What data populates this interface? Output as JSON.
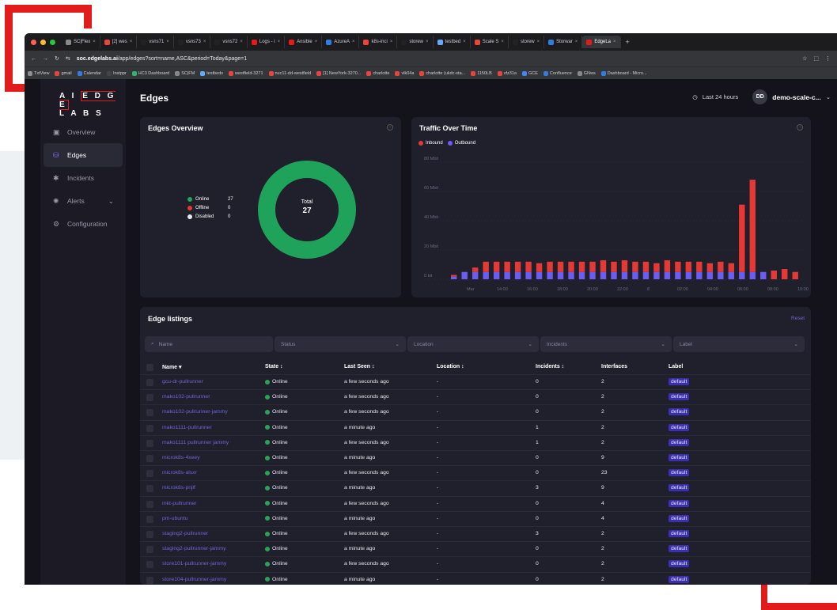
{
  "browser": {
    "tabs": [
      {
        "label": "SC|Flex",
        "color": "#888888"
      },
      {
        "label": "[2] wes",
        "color": "#e8453c"
      },
      {
        "label": "vsns71",
        "color": "#222222"
      },
      {
        "label": "vsns73",
        "color": "#222222"
      },
      {
        "label": "vsns72",
        "color": "#222222"
      },
      {
        "label": "Logs - i",
        "color": "#e21b1b"
      },
      {
        "label": "Ansible",
        "color": "#e21b1b"
      },
      {
        "label": "AzureA",
        "color": "#2f7de1"
      },
      {
        "label": "k8s-inci",
        "color": "#e8453c"
      },
      {
        "label": "storew",
        "color": "#222222"
      },
      {
        "label": "testbed",
        "color": "#6aa7ff"
      },
      {
        "label": "Scale S",
        "color": "#e8453c"
      },
      {
        "label": "storew",
        "color": "#222222"
      },
      {
        "label": "Storwar",
        "color": "#2f7de1"
      },
      {
        "label": "EdgeLa",
        "color": "#e21b1b",
        "active": true
      }
    ],
    "new_tab": "+",
    "url_host": "soc.edgelabs.ai",
    "url_path": "/app/edges?sort=name,ASC&period=Today&page=1",
    "bookmarks": [
      "TxtView",
      "gmail",
      "Calendar",
      "Instppr",
      "HC3 Dashboard",
      "SC|FM",
      "testbeds",
      "westfield-3271",
      "nuc11-dd-westfield",
      "[1] NewYork-3270...",
      "charlotte",
      "vlk04a",
      "charlotte (ukdc-sta...",
      "1150LB",
      "vfz31a",
      "GCE",
      "Confluence",
      "GNws",
      "Dashboard - Micro..."
    ]
  },
  "logo": {
    "part1": "A I",
    "boxed": "E D G E",
    "part2": "L A B S"
  },
  "sidebar": {
    "items": [
      {
        "label": "Overview",
        "icon": "overview-icon",
        "glyph": "▣"
      },
      {
        "label": "Edges",
        "icon": "edges-icon",
        "glyph": "⛁",
        "active": true
      },
      {
        "label": "Incidents",
        "icon": "incidents-icon",
        "glyph": "✱"
      },
      {
        "label": "Alerts",
        "icon": "alerts-icon",
        "glyph": "✺",
        "chevron": "⌄"
      },
      {
        "label": "Configuration",
        "icon": "configuration-icon",
        "glyph": "⚙"
      }
    ]
  },
  "header": {
    "title": "Edges",
    "period": "Last 24 hours",
    "avatar": "DD",
    "account": "demo-scale-c...",
    "clock_glyph": "◷",
    "chevron": "⌄"
  },
  "overview": {
    "title": "Edges Overview",
    "legend": [
      {
        "label": "Online",
        "value": "27",
        "color": "#22a65a"
      },
      {
        "label": "Offline",
        "value": "0",
        "color": "#e53935"
      },
      {
        "label": "Disabled",
        "value": "0",
        "color": "#e9e8ef"
      }
    ],
    "total_label": "Total",
    "total_value": "27",
    "donut_color": "#1fa35a"
  },
  "traffic": {
    "title": "Traffic Over Time",
    "legend": [
      {
        "label": "Inbound",
        "color": "#e53935"
      },
      {
        "label": "Outbound",
        "color": "#6a5cf5"
      }
    ]
  },
  "chart_data": {
    "type": "bar",
    "stacked": true,
    "title": "Traffic Over Time",
    "y_ticks": [
      "80 Mbit",
      "60 Mbit",
      "40 Mbit",
      "20 Mbit",
      "0 bit"
    ],
    "ylim": [
      0,
      80
    ],
    "x_ticks": [
      "Mar",
      "14:00",
      "16:00",
      "18:00",
      "20:00",
      "22:00",
      "8",
      "02:00",
      "04:00",
      "06:00",
      "08:00",
      "10:00"
    ],
    "series": [
      {
        "name": "Outbound",
        "color": "#6a5cf5",
        "values": [
          2,
          5,
          5,
          5,
          5,
          5,
          5,
          5,
          5,
          5,
          5,
          5,
          5,
          5,
          5,
          5,
          5,
          5,
          5,
          5,
          5,
          5,
          5,
          5,
          5,
          5,
          5,
          5,
          5,
          5
        ]
      },
      {
        "name": "Inbound",
        "color": "#e53935",
        "values": [
          1,
          0,
          3,
          7,
          7,
          7,
          7,
          7,
          6,
          7,
          7,
          7,
          7,
          7,
          8,
          7,
          8,
          7,
          7,
          6,
          8,
          7,
          7,
          7,
          6,
          7,
          6,
          46,
          63,
          0,
          6,
          7,
          5
        ]
      }
    ],
    "grid": true,
    "legend_position": "top-left"
  },
  "listings": {
    "title": "Edge listings",
    "reset": "Reset",
    "search_placeholder": "Name",
    "search_glyph": "⌕",
    "filters": [
      "Status",
      "Location",
      "Incidents",
      "Label"
    ],
    "chevron": "⌄",
    "columns": [
      "Name ▾",
      "State ↕",
      "Last Seen ↕",
      "Location ↕",
      "Incidents ↕",
      "Interfaces",
      "Label"
    ],
    "rows": [
      {
        "name": "gcu-dr-pullrunner",
        "state": "Online",
        "last_seen": "a few seconds ago",
        "location": "-",
        "incidents": "0",
        "interfaces": "2",
        "label": "default"
      },
      {
        "name": "mako102-pullrunner",
        "state": "Online",
        "last_seen": "a few seconds ago",
        "location": "-",
        "incidents": "0",
        "interfaces": "2",
        "label": "default"
      },
      {
        "name": "mako102-pullrunner-jammy",
        "state": "Online",
        "last_seen": "a few seconds ago",
        "location": "-",
        "incidents": "0",
        "interfaces": "2",
        "label": "default"
      },
      {
        "name": "mako1111-pullrunner",
        "state": "Online",
        "last_seen": "a minute ago",
        "location": "-",
        "incidents": "1",
        "interfaces": "2",
        "label": "default"
      },
      {
        "name": "mako1111 pullrunner jammy",
        "state": "Online",
        "last_seen": "a few seconds ago",
        "location": "-",
        "incidents": "1",
        "interfaces": "2",
        "label": "default"
      },
      {
        "name": "microk8s-4xeey",
        "state": "Online",
        "last_seen": "a minute ago",
        "location": "-",
        "incidents": "0",
        "interfaces": "9",
        "label": "default"
      },
      {
        "name": "microk8s-alsxr",
        "state": "Online",
        "last_seen": "a few seconds ago",
        "location": "-",
        "incidents": "0",
        "interfaces": "23",
        "label": "default"
      },
      {
        "name": "microk8s-pnjlf",
        "state": "Online",
        "last_seen": "a minute ago",
        "location": "-",
        "incidents": "3",
        "interfaces": "9",
        "label": "default"
      },
      {
        "name": "mkt-pullrunner",
        "state": "Online",
        "last_seen": "a few seconds ago",
        "location": "-",
        "incidents": "0",
        "interfaces": "4",
        "label": "default"
      },
      {
        "name": "pm-ubuntu",
        "state": "Online",
        "last_seen": "a minute ago",
        "location": "-",
        "incidents": "0",
        "interfaces": "4",
        "label": "default"
      },
      {
        "name": "staging2-pullrunner",
        "state": "Online",
        "last_seen": "a few seconds ago",
        "location": "-",
        "incidents": "3",
        "interfaces": "2",
        "label": "default"
      },
      {
        "name": "staging2-pullrunner-jammy",
        "state": "Online",
        "last_seen": "a minute ago",
        "location": "-",
        "incidents": "0",
        "interfaces": "2",
        "label": "default"
      },
      {
        "name": "store101-pullrunner-jammy",
        "state": "Online",
        "last_seen": "a few seconds ago",
        "location": "-",
        "incidents": "0",
        "interfaces": "2",
        "label": "default"
      },
      {
        "name": "store104-pullrunner-jammy",
        "state": "Online",
        "last_seen": "a minute ago",
        "location": "-",
        "incidents": "0",
        "interfaces": "2",
        "label": "default"
      }
    ]
  }
}
